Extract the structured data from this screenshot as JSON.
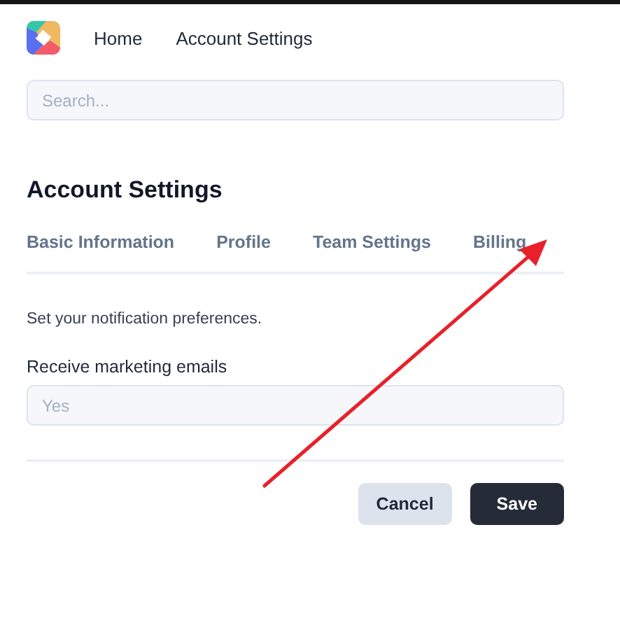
{
  "nav": {
    "links": [
      "Home",
      "Account Settings"
    ]
  },
  "search": {
    "placeholder": "Search..."
  },
  "page_title": "Account Settings",
  "tabs": [
    {
      "label": "Basic Information",
      "selected": false
    },
    {
      "label": "Profile",
      "selected": false
    },
    {
      "label": "Team Settings",
      "selected": false
    },
    {
      "label": "Billing",
      "selected": false
    }
  ],
  "description": "Set your notification preferences.",
  "field": {
    "label": "Receive marketing emails",
    "placeholder": "Yes"
  },
  "buttons": [
    {
      "label": "Cancel",
      "kind": "secondary"
    },
    {
      "label": "Save",
      "kind": "primary"
    }
  ]
}
